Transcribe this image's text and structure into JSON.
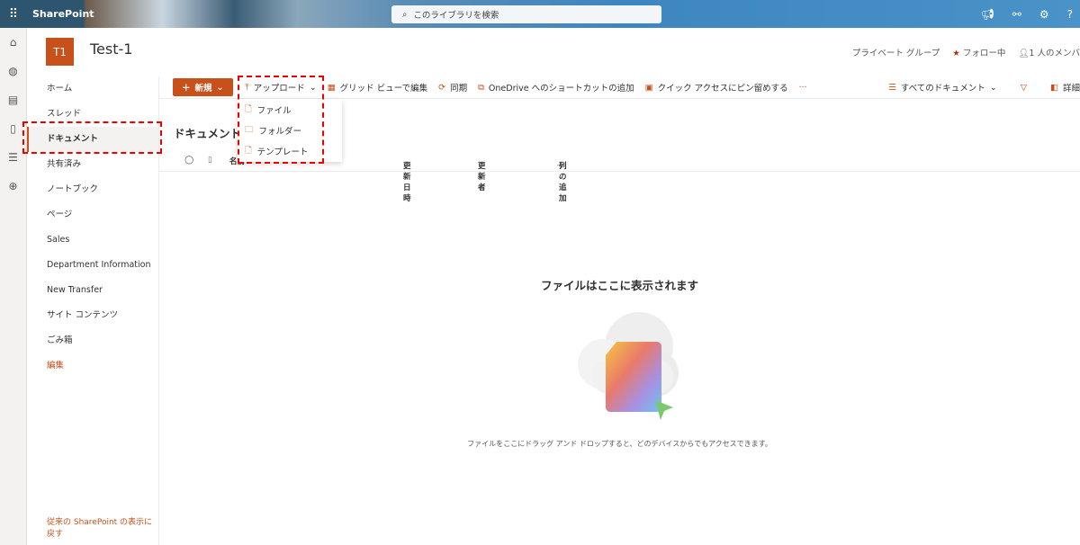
{
  "topbar": {
    "brand": "SharePoint",
    "search_placeholder": "このライブラリを検索"
  },
  "site": {
    "logo": "T1",
    "title": "Test-1",
    "privacy": "プライベート グループ",
    "follow": "フォロー中",
    "members": "1 人のメンバ"
  },
  "nav": {
    "items": [
      "ホーム",
      "スレッド",
      "ドキュメント",
      "共有済み",
      "ノートブック",
      "ページ",
      "Sales",
      "Department Information",
      "New Transfer",
      "サイト コンテンツ",
      "ごみ箱"
    ],
    "edit": "編集",
    "legacy": "従来の SharePoint の表示に戻す"
  },
  "toolbar": {
    "new": "新規",
    "upload": "アップロード",
    "grid": "グリッド ビューで編集",
    "sync": "同期",
    "onedrive": "OneDrive へのショートカットの追加",
    "pin": "クイック アクセスにピン留めする",
    "more": "···",
    "view": "すべてのドキュメント",
    "details": "詳細"
  },
  "upload_menu": [
    "ファイル",
    "フォルダー",
    "テンプレート"
  ],
  "library": {
    "title": "ドキュメント",
    "columns": {
      "name": "名前",
      "modified": "更新日時",
      "modified_by": "更新者",
      "add": "列の追加"
    }
  },
  "empty": {
    "title": "ファイルはここに表示されます",
    "caption": "ファイルをここにドラッグ アンド ドロップすると、どのデバイスからでもアクセスできます。"
  }
}
